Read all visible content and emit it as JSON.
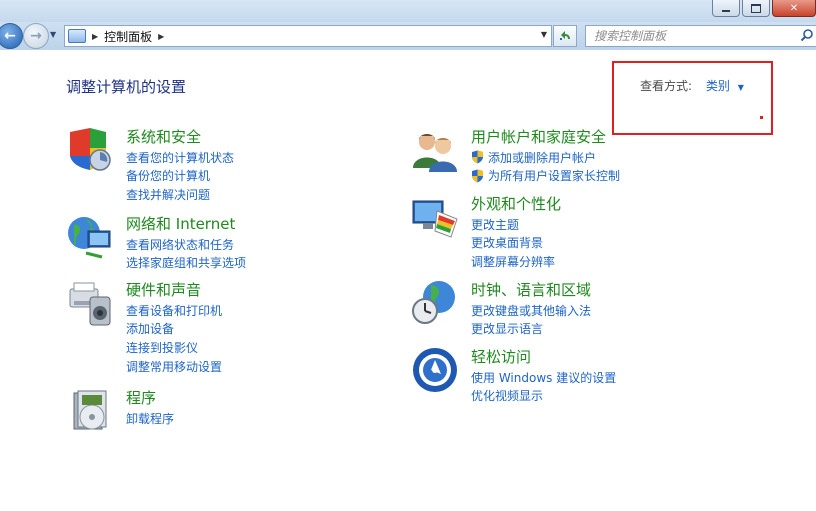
{
  "window": {
    "colors": {
      "accent": "#1e64c8",
      "category_title": "#1e8a1e",
      "page_title": "#1e3287",
      "highlight_box": "#e02020"
    }
  },
  "navigation": {
    "breadcrumb": "控制面板",
    "search_placeholder": "搜索控制面板"
  },
  "page": {
    "title": "调整计算机的设置",
    "view_by_label": "查看方式:",
    "view_by_value": "类别"
  },
  "categories_left": [
    {
      "icon": "system-security-icon",
      "title": "系统和安全",
      "links": [
        "查看您的计算机状态",
        "备份您的计算机",
        "查找并解决问题"
      ]
    },
    {
      "icon": "network-icon",
      "title": "网络和 Internet",
      "links": [
        "查看网络状态和任务",
        "选择家庭组和共享选项"
      ]
    },
    {
      "icon": "hardware-sound-icon",
      "title": "硬件和声音",
      "links": [
        "查看设备和打印机",
        "添加设备",
        "连接到投影仪",
        "调整常用移动设置"
      ]
    },
    {
      "icon": "programs-icon",
      "title": "程序",
      "links": [
        "卸载程序"
      ]
    }
  ],
  "categories_right": [
    {
      "icon": "user-accounts-icon",
      "title": "用户帐户和家庭安全",
      "links": [
        "添加或删除用户帐户",
        "为所有用户设置家长控制"
      ],
      "shield_links": true
    },
    {
      "icon": "appearance-icon",
      "title": "外观和个性化",
      "links": [
        "更改主题",
        "更改桌面背景",
        "调整屏幕分辨率"
      ]
    },
    {
      "icon": "clock-language-icon",
      "title": "时钟、语言和区域",
      "links": [
        "更改键盘或其他输入法",
        "更改显示语言"
      ]
    },
    {
      "icon": "ease-of-access-icon",
      "title": "轻松访问",
      "links": [
        "使用 Windows 建议的设置",
        "优化视频显示"
      ]
    }
  ]
}
